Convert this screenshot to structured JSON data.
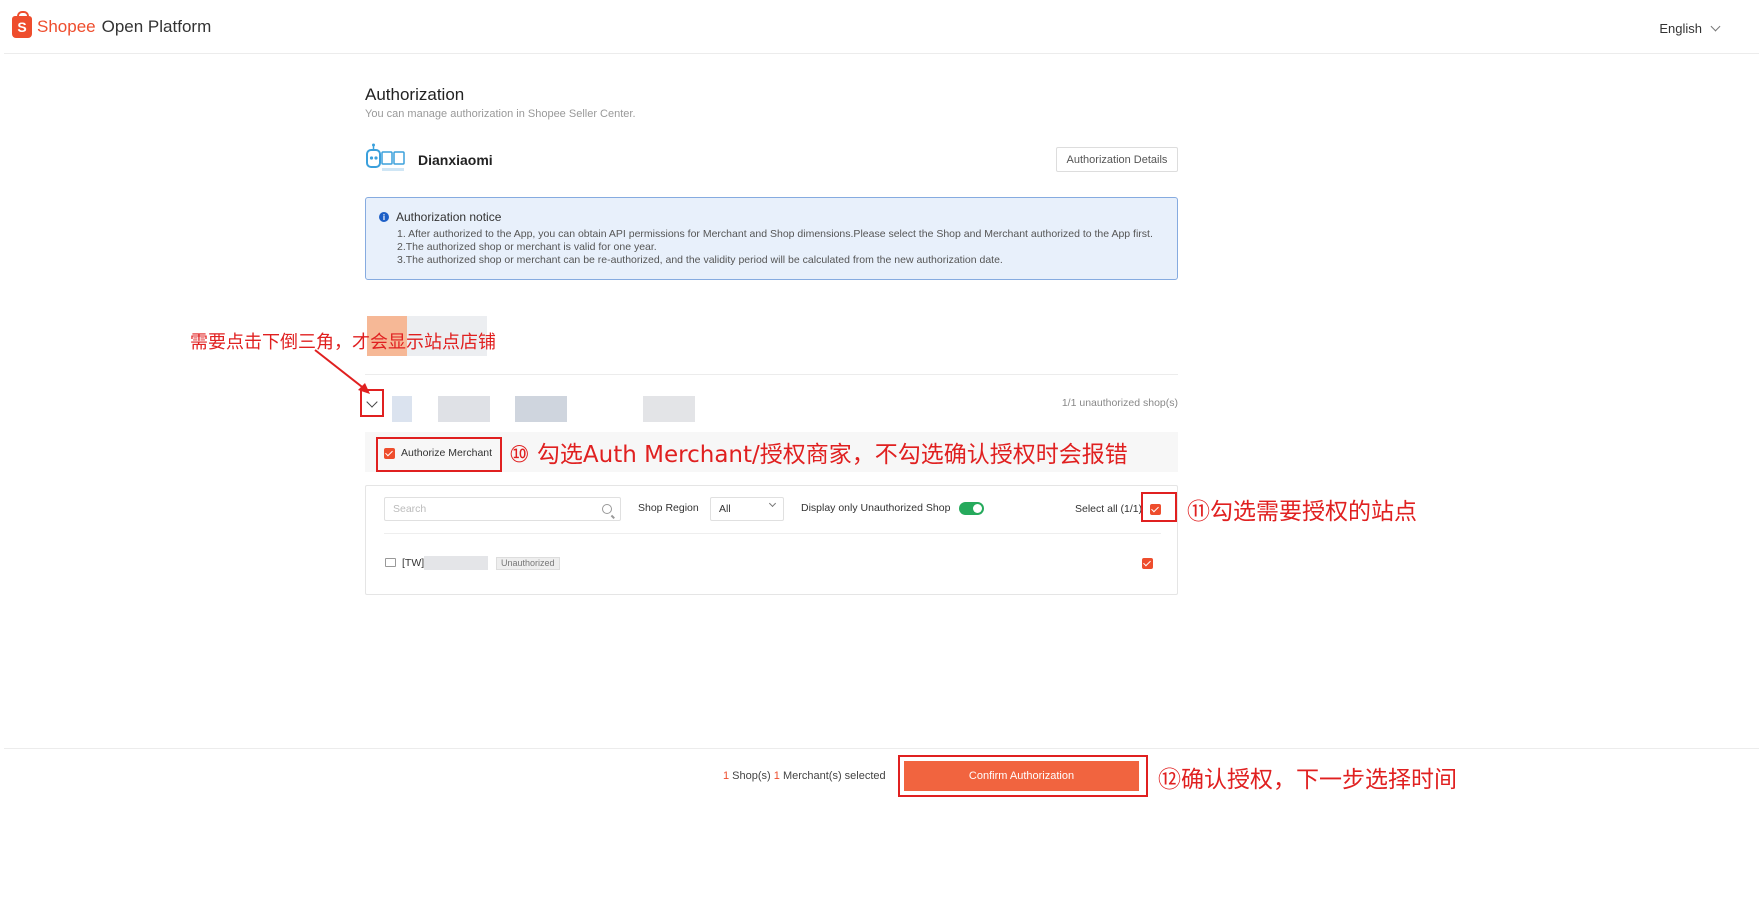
{
  "header": {
    "brand": "Shopee",
    "brand_sub": "Open Platform",
    "language": "English"
  },
  "page": {
    "title": "Authorization",
    "subtitle": "You can manage authorization in Shopee Seller Center."
  },
  "app": {
    "name": "Dianxiaomi",
    "details_label": "Authorization Details"
  },
  "notice": {
    "title": "Authorization notice",
    "lines": [
      "1. After authorized to the App, you can obtain API permissions for Merchant and Shop dimensions.Please select the Shop and Merchant authorized to the App first.",
      "2.The authorized shop or merchant is valid for one year.",
      "3.The authorized shop or merchant can be re-authorized, and the validity period will be calculated from the new authorization date."
    ]
  },
  "annotations": {
    "triangle_hint": "需要点击下倒三角，才会显示站点店铺",
    "step10": "⑩ 勾选Auth Merchant/授权商家，不勾选确认授权时会报错",
    "step11": "⑪勾选需要授权的站点",
    "step12": "⑫确认授权，下一步选择时间"
  },
  "merchant": {
    "unauthorized_count": "1/1 unauthorized shop(s)",
    "authorize_label": "Authorize Merchant"
  },
  "filters": {
    "search_placeholder": "Search",
    "region_label": "Shop Region",
    "region_value": "All",
    "only_unauthorized_label": "Display only Unauthorized Shop",
    "select_all_label": "Select all (1/1)"
  },
  "shops": [
    {
      "name": "[TW]",
      "status": "Unauthorized"
    }
  ],
  "footer": {
    "shop_count": "1",
    "shop_label": " Shop(s) ",
    "merchant_count": "1",
    "merchant_label": " Merchant(s) selected",
    "confirm_label": "Confirm Authorization"
  },
  "colors": {
    "brand": "#ee4d2d",
    "annotation": "#e02020",
    "toggle_on": "#26aa5c",
    "notice_bg": "#e8f0fb"
  }
}
